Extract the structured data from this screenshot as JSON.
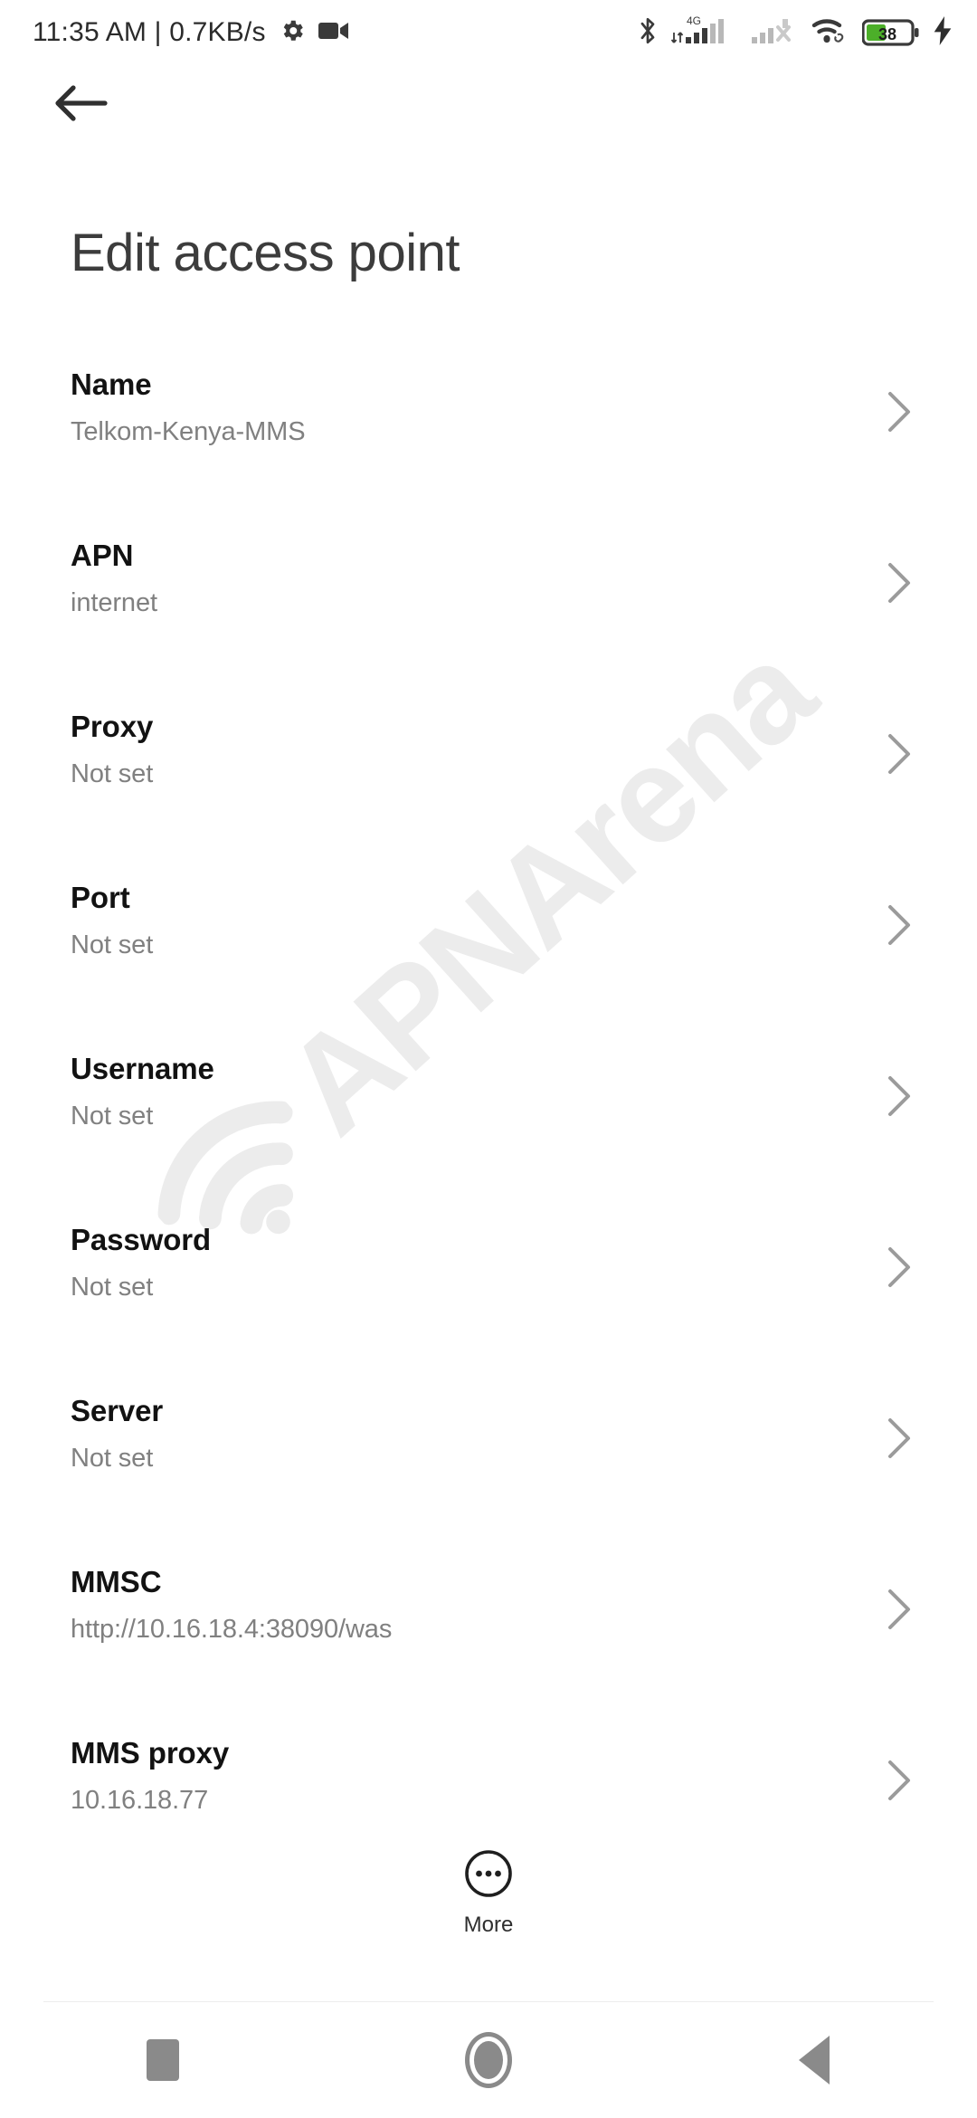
{
  "statusbar": {
    "clock": "11:35 AM | 0.7KB/s",
    "gear_icon": "gear-icon",
    "video_icon": "video-camera-icon",
    "bluetooth_icon": "bluetooth-icon",
    "network_type": "4G",
    "signal_icon": "signal-bars-icon",
    "signal2_icon": "signal-no-service-icon",
    "wifi_icon": "wifi-icon",
    "battery_level": "38",
    "battery_icon": "battery-icon",
    "charging_icon": "charging-bolt-icon",
    "battery_color": "#4caf29"
  },
  "header": {
    "back_icon": "back-arrow-icon",
    "title": "Edit access point"
  },
  "watermark": {
    "text": "APNArena",
    "icon": "wifi-signal-icon",
    "color": "#ececec"
  },
  "settings": {
    "chevron_icon": "chevron-right-icon",
    "rows": [
      {
        "label": "Name",
        "value": "Telkom-Kenya-MMS"
      },
      {
        "label": "APN",
        "value": "internet"
      },
      {
        "label": "Proxy",
        "value": "Not set"
      },
      {
        "label": "Port",
        "value": "Not set"
      },
      {
        "label": "Username",
        "value": "Not set"
      },
      {
        "label": "Password",
        "value": "Not set"
      },
      {
        "label": "Server",
        "value": "Not set"
      },
      {
        "label": "MMSC",
        "value": "http://10.16.18.4:38090/was"
      },
      {
        "label": "MMS proxy",
        "value": "10.16.18.77"
      }
    ]
  },
  "more": {
    "label": "More",
    "icon": "more-dots-circle-icon"
  },
  "navbar": {
    "recents_icon": "recents-square-icon",
    "home_icon": "home-circle-icon",
    "back_icon": "back-triangle-icon"
  }
}
